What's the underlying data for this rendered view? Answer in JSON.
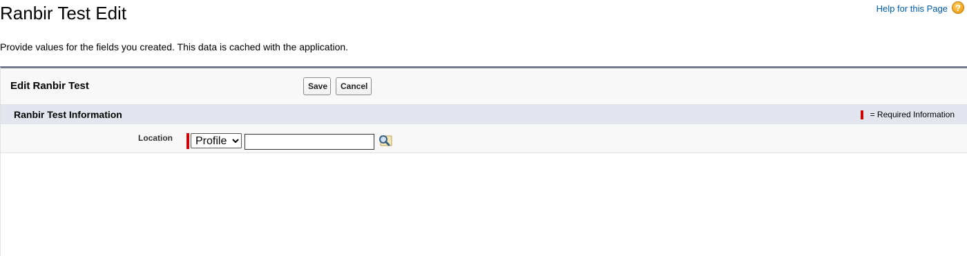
{
  "page": {
    "title": "Ranbir Test Edit",
    "description": "Provide values for the fields you created. This data is cached with the application.",
    "help_link": "Help for this Page",
    "help_icon": "question-icon"
  },
  "edit_panel": {
    "title": "Edit Ranbir Test",
    "save_label": "Save",
    "cancel_label": "Cancel"
  },
  "section": {
    "title": "Ranbir Test Information",
    "required_legend": "= Required Information",
    "required_color": "#cc0000"
  },
  "fields": {
    "location": {
      "label": "Location",
      "type_options": [
        "Profile"
      ],
      "type_selected": "Profile",
      "value": "",
      "lookup_icon": "lookup-magnifier-icon"
    }
  },
  "colors": {
    "panel_border": "#6f7a8a",
    "section_bg": "#e3e6ee",
    "link": "#015ba7"
  }
}
